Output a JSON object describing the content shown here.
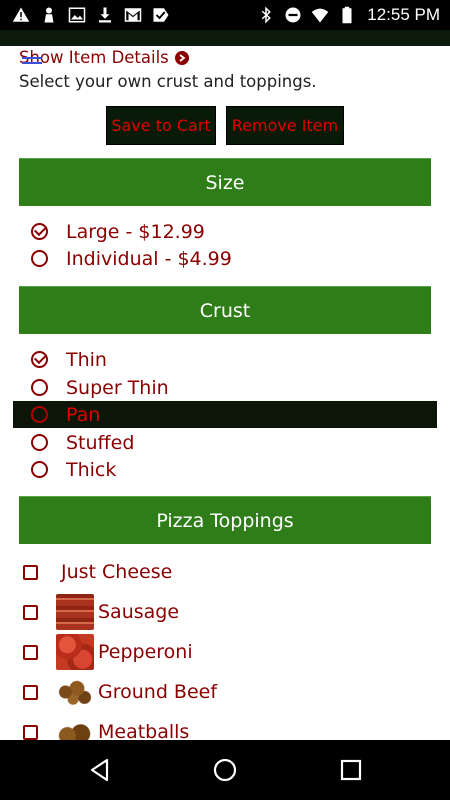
{
  "status_bar": {
    "time": "12:55 PM",
    "left_icons": [
      "warning-icon",
      "chess-pawn-icon",
      "image-icon",
      "download-icon",
      "gmail-icon",
      "checkmark-app-icon"
    ],
    "right_icons": [
      "bluetooth-icon",
      "do-not-disturb-icon",
      "wifi-icon",
      "battery-icon"
    ]
  },
  "header": {
    "details_link": "Show Item Details",
    "subtitle": "Select your own crust and toppings."
  },
  "actions": {
    "save_label": "Save to Cart",
    "remove_label": "Remove Item"
  },
  "size": {
    "title": "Size",
    "options": [
      {
        "label": "Large - $12.99",
        "checked": true
      },
      {
        "label": "Individual - $4.99",
        "checked": false
      }
    ]
  },
  "crust": {
    "title": "Crust",
    "options": [
      {
        "label": "Thin",
        "checked": true
      },
      {
        "label": "Super Thin",
        "checked": false
      },
      {
        "label": "Pan",
        "checked": false,
        "highlighted": true
      },
      {
        "label": "Stuffed",
        "checked": false
      },
      {
        "label": "Thick",
        "checked": false
      }
    ]
  },
  "toppings": {
    "title": "Pizza Toppings",
    "items": [
      {
        "label": "Just Cheese",
        "has_image": false
      },
      {
        "label": "Sausage",
        "has_image": true
      },
      {
        "label": "Pepperoni",
        "has_image": true
      },
      {
        "label": "Ground Beef",
        "has_image": true
      },
      {
        "label": "Meatballs",
        "has_image": true
      }
    ]
  },
  "colors": {
    "accent_green": "#2e7d18",
    "text_red": "#8b0000",
    "button_bg": "#0a1a08",
    "button_text": "#e00000"
  }
}
